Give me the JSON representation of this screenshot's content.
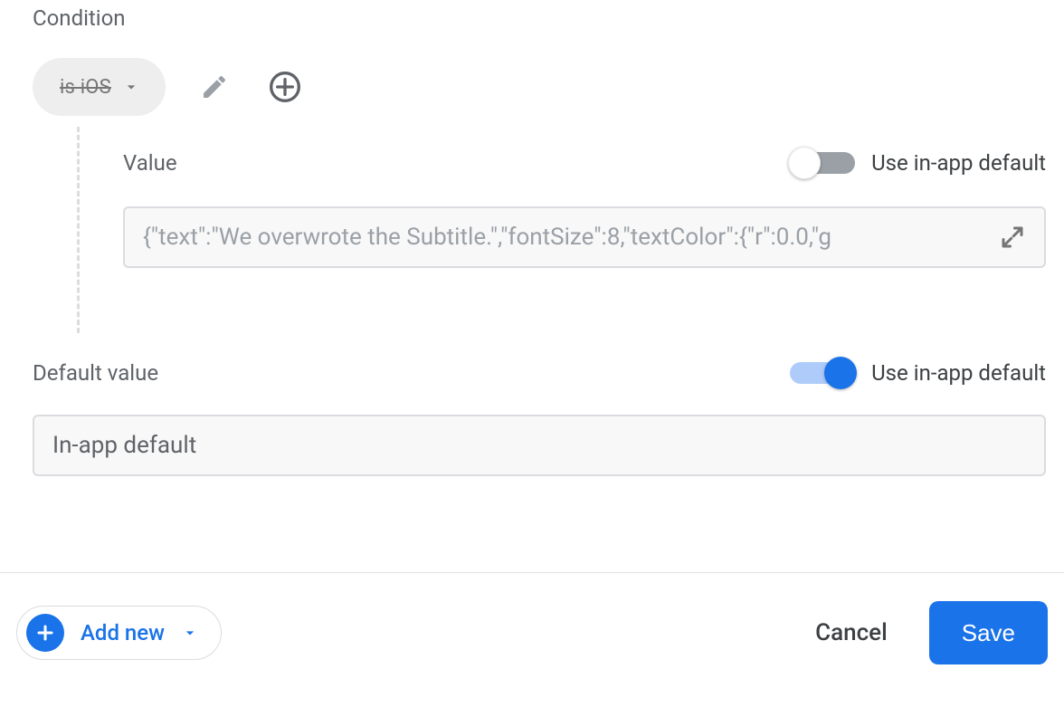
{
  "condition": {
    "label": "Condition",
    "chip_label": "is iOS"
  },
  "toggle_label": "Use in-app default",
  "value": {
    "label": "Value",
    "use_default": false,
    "text": "{\"text\":\"We overwrote the Subtitle.\",\"fontSize\":8,\"textColor\":{\"r\":0.0,\"g"
  },
  "default": {
    "label": "Default value",
    "use_default": true,
    "text": "In-app default"
  },
  "footer": {
    "add_new": "Add new",
    "cancel": "Cancel",
    "save": "Save"
  }
}
